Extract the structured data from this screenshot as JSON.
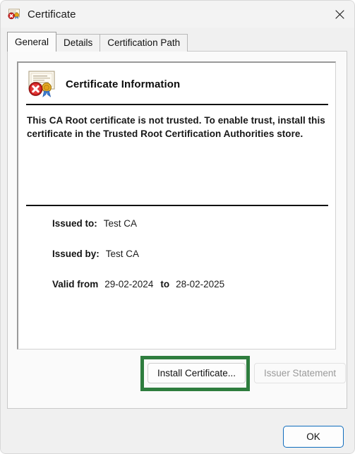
{
  "window": {
    "title": "Certificate",
    "icon": "certificate-error-icon",
    "close_label": "✕"
  },
  "tabs": [
    {
      "label": "General",
      "active": true
    },
    {
      "label": "Details",
      "active": false
    },
    {
      "label": "Certification Path",
      "active": false
    }
  ],
  "general": {
    "header_icon": "certificate-error-icon",
    "header_title": "Certificate Information",
    "warning_text": "This CA Root certificate is not trusted. To enable trust, install this certificate in the Trusted Root Certification Authorities store.",
    "fields": {
      "issued_to_label": "Issued to:",
      "issued_to_value": "Test CA",
      "issued_by_label": "Issued by:",
      "issued_by_value": "Test CA",
      "valid_from_label": "Valid from",
      "valid_from_value": "29-02-2024",
      "valid_to_separator": "to",
      "valid_to_value": "28-02-2025"
    },
    "buttons": {
      "install_certificate": "Install Certificate...",
      "issuer_statement": "Issuer Statement",
      "issuer_statement_disabled": true
    }
  },
  "footer": {
    "ok_label": "OK"
  },
  "annotation": {
    "highlight_color": "#2e7d3e",
    "highlight_target": "Install Certificate..."
  },
  "colors": {
    "accent": "#0f6cbd",
    "window_bg": "#f0f0f0",
    "panel_bg": "#fafafa",
    "cert_bg": "#ffffff",
    "error_red": "#d32020",
    "seal_gold": "#e8a317"
  }
}
